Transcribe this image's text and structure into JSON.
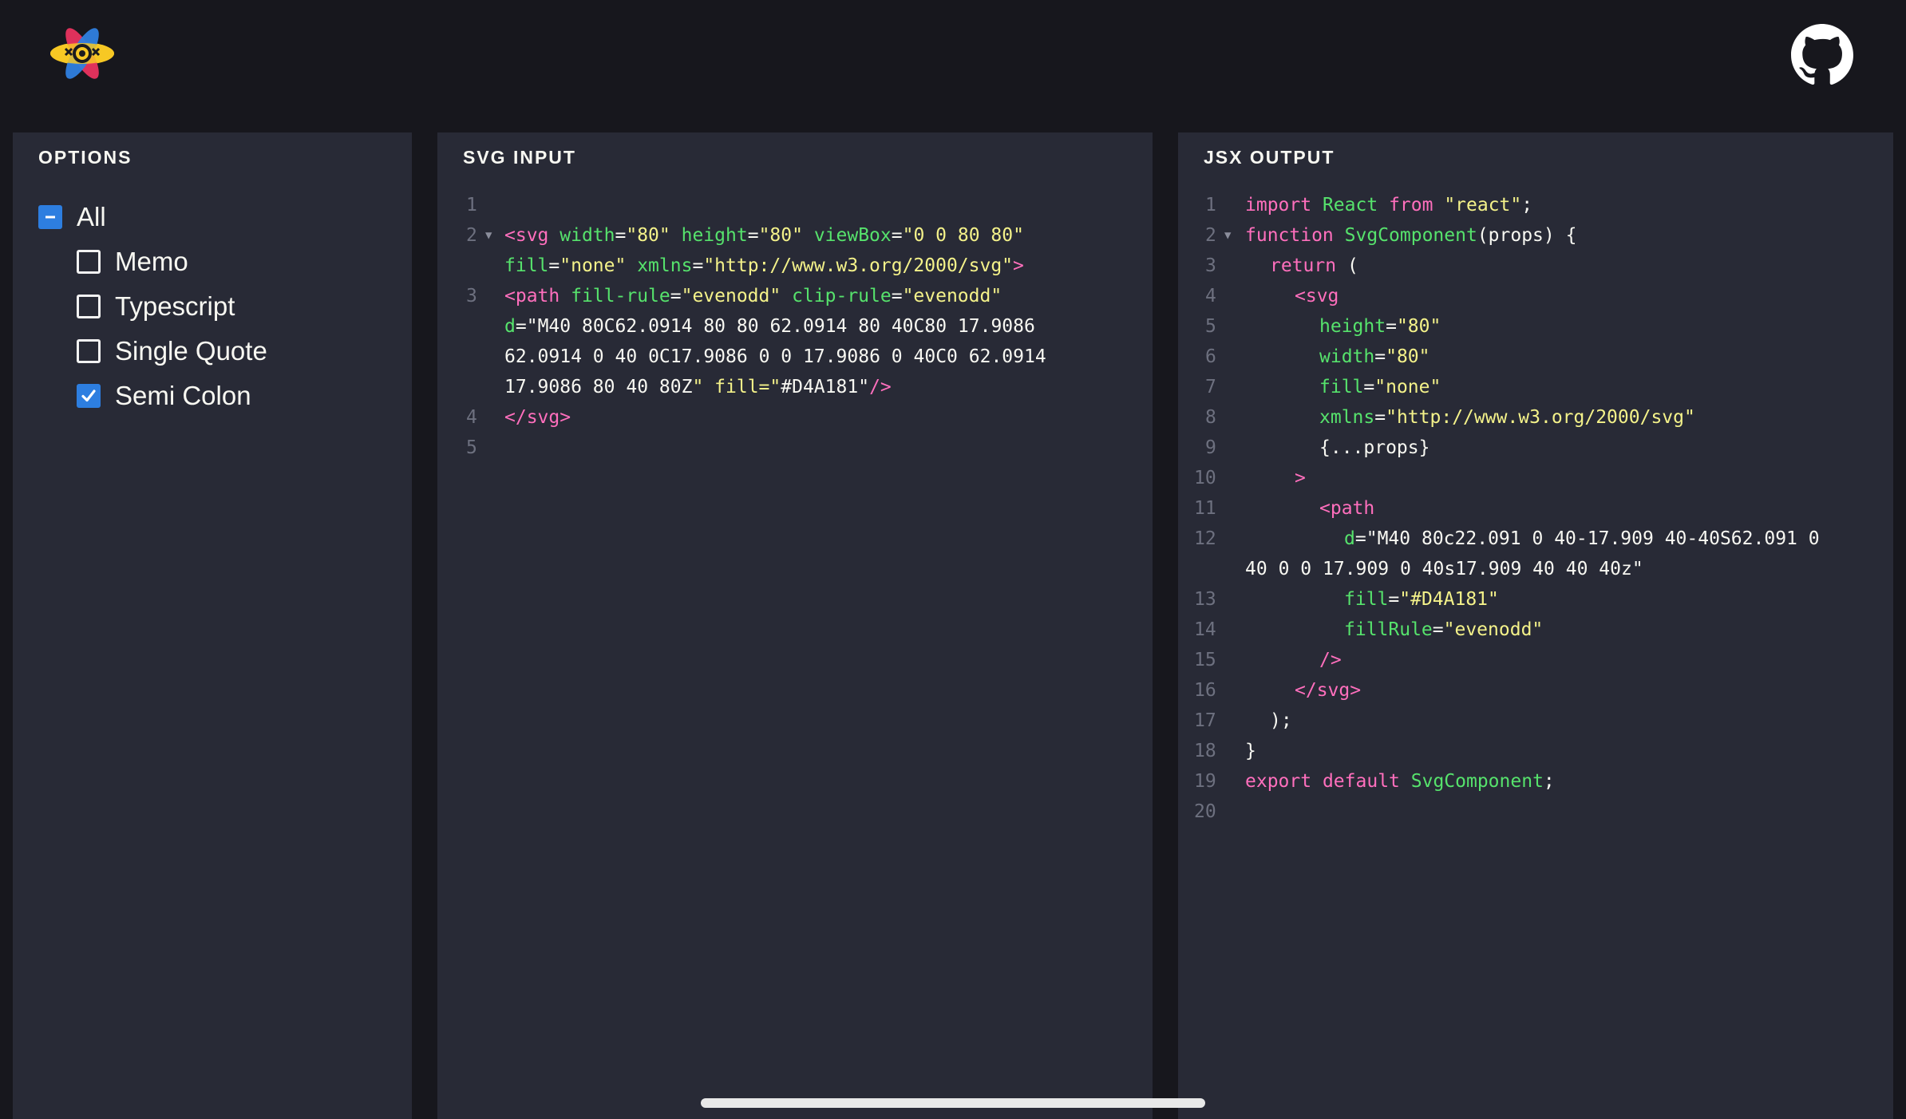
{
  "header": {
    "logo_icon": "react-atom-logo-icon",
    "github_icon": "github-icon"
  },
  "options": {
    "title": "OPTIONS",
    "items": [
      {
        "label": "All",
        "state": "indeterminate"
      },
      {
        "label": "Memo",
        "state": "unchecked"
      },
      {
        "label": "Typescript",
        "state": "unchecked"
      },
      {
        "label": "Single Quote",
        "state": "unchecked"
      },
      {
        "label": "Semi Colon",
        "state": "checked"
      }
    ]
  },
  "svg_input": {
    "title": "SVG INPUT",
    "line_numbers": [
      "1",
      "2",
      "3",
      "4",
      "5"
    ],
    "lines": [
      "<svg width=\"80\" height=\"80\" viewBox=\"0 0 80 80\"",
      "fill=\"none\" xmlns=\"http://www.w3.org/2000/svg\">",
      "<path fill-rule=\"evenodd\" clip-rule=\"evenodd\"",
      "d=\"M40 80C62.0914 80 80 62.0914 80 40C80 17.9086",
      "62.0914 0 40 0C17.9086 0 0 17.9086 0 40C0 62.0914",
      "17.9086 80 40 80Z\" fill=\"#D4A181\"/>",
      "</svg>"
    ]
  },
  "jsx_output": {
    "title": "JSX OUTPUT",
    "line_numbers": [
      "1",
      "2",
      "3",
      "4",
      "5",
      "6",
      "7",
      "8",
      "9",
      "10",
      "11",
      "12",
      "13",
      "14",
      "15",
      "16",
      "17",
      "18",
      "19",
      "20"
    ],
    "lines": [
      "import React from \"react\";",
      "function SvgComponent(props) {",
      "return (",
      "<svg",
      "height=\"80\"",
      "width=\"80\"",
      "fill=\"none\"",
      "xmlns=\"http://www.w3.org/2000/svg\"",
      "{...props}",
      ">",
      "<path",
      "d=\"M40 80c22.091 0 40-17.909 40-40S62.091 0",
      "40 0 0 17.909 0 40s17.909 40 40 40z\"",
      "fill=\"#D4A181\"",
      "fillRule=\"evenodd\"",
      "/>",
      "</svg>",
      ");",
      "}",
      "export default SvgComponent;"
    ]
  },
  "colors": {
    "background": "#17171d",
    "panel": "#282a36",
    "checkbox_accent": "#2d7ee0",
    "tag": "#ff6fbd",
    "attribute": "#56e26c",
    "string": "#f4f28a",
    "line_number": "#6d707f"
  }
}
